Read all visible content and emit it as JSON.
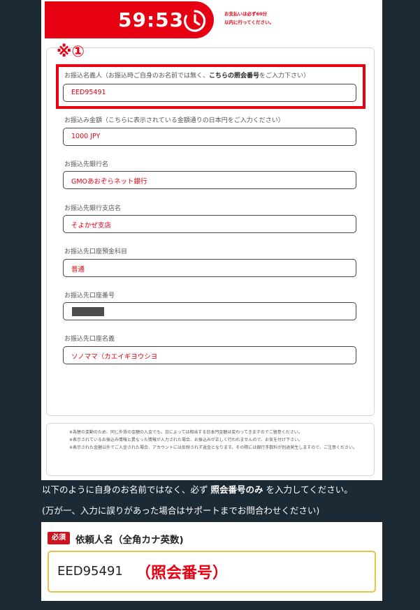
{
  "timer": {
    "time": "59:53",
    "note_line1": "お支払いは必ず60分",
    "note_line2": "以内に行ってください。"
  },
  "marker": "※①",
  "fields": [
    {
      "label_pre": "お振込名義人（お振込時ご自身のお名前では無く、",
      "label_bold": "こちらの照会番号",
      "label_post": "をご入力下さい）",
      "value": "EED95491"
    },
    {
      "label": "お振込み金額（こちらに表示されている金額通りの日本円をご入力ください）",
      "value": "1000 JPY"
    },
    {
      "label": "お振込先銀行名",
      "value": "GMOあおぞらネット銀行"
    },
    {
      "label": "お振込先銀行支店名",
      "value": "そよかぜ支店"
    },
    {
      "label": "お振込先口座預金科目",
      "value": "普通"
    },
    {
      "label": "お振込先口座番号",
      "value": ""
    },
    {
      "label": "お振込先口座名義",
      "value": "ソノママ（カエイギヨウシヨ"
    }
  ],
  "notes": [
    "※為替の変動のため、同じ外貨の金額の入金でも、日によっては相当する日本円金額は変わってきますのでご留意ください。",
    "※表示されているお振込み情報と異なった情報が入力された場合、お振込みが正しく行われませんので、お気を付け下さい。",
    "※表示された金額以外でご入金された場合、アカウントには反映されず返金となります。その際には銀行手数料が別途発生しますので、ご注意ください。"
  ],
  "instructions": {
    "line1_pre": "以下のように自身のお名前ではなく、必ず ",
    "line1_bold": "照会番号のみ",
    "line1_post": " を入力してください。",
    "line2": "(万が一、入力に誤りがあった場合はサポートまでお問合わせください)"
  },
  "requester": {
    "badge": "必須",
    "label": "依頼人名（全角カナ英数)",
    "value": "EED95491",
    "hint": "（照会番号）"
  },
  "colors": {
    "brand_red": "#e60012",
    "background": "#1c2a35",
    "input_border_gold": "#e6c349"
  }
}
